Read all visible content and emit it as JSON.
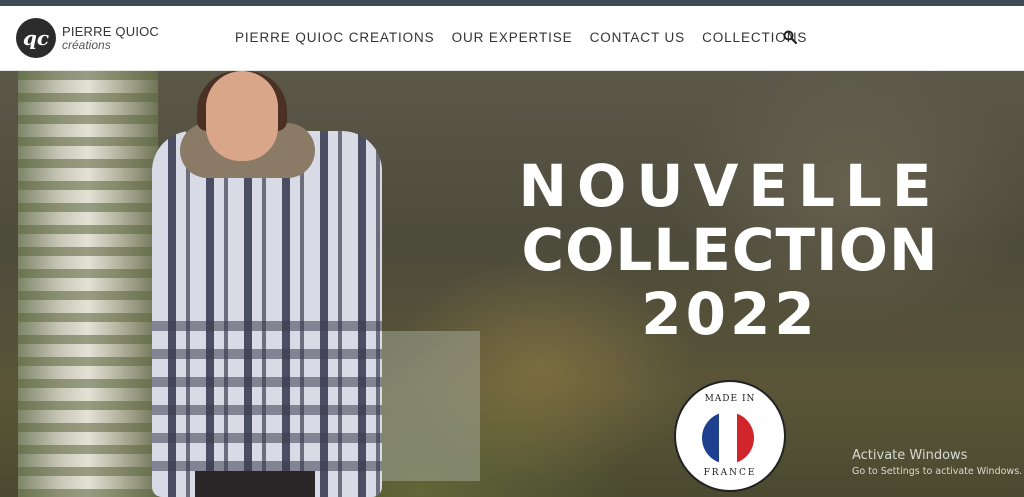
{
  "brand": {
    "logo_mark": "qc",
    "name": "PIERRE QUIOC",
    "sub": "créations"
  },
  "nav": {
    "items": [
      {
        "label": "PIERRE QUIOC CREATIONS"
      },
      {
        "label": "OUR EXPERTISE"
      },
      {
        "label": "CONTACT US"
      },
      {
        "label": "COLLECTIONS"
      }
    ],
    "search_icon": "search-icon"
  },
  "hero": {
    "line1": "NOUVELLE",
    "line2": "COLLECTION",
    "line3": "2022",
    "badge": {
      "top": "MADE IN",
      "bottom": "FRANCE",
      "flag_colors": [
        "#1f3f8f",
        "#ffffff",
        "#d0252b"
      ]
    }
  },
  "watermark": {
    "title": "Activate Windows",
    "subtitle": "Go to Settings to activate Windows."
  },
  "colors": {
    "top_strip": "#3e4a55",
    "nav_text": "#333333",
    "headline": "#ffffff"
  }
}
